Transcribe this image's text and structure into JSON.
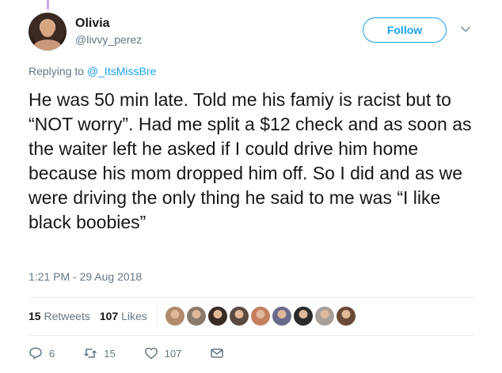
{
  "user": {
    "display_name": "Olivia",
    "handle": "@livvy_perez"
  },
  "follow_label": "Follow",
  "reply": {
    "prefix": "Replying to",
    "mention": "@_ItsMissBre"
  },
  "tweet": {
    "text": "He was 50 min late. Told me his famiy is racist but to “NOT worry”. Had me split a $12 check and as soon as the waiter left he asked if I could drive him home because his mom dropped him off. So I did and as we were driving the only thing he said to me was “I like black boobies”",
    "timestamp": "1:21 PM - 29 Aug 2018"
  },
  "stats": {
    "retweets_count": "15",
    "retweets_label": "Retweets",
    "likes_count": "107",
    "likes_label": "Likes"
  },
  "likers": [
    {
      "color": "#b08a6a"
    },
    {
      "color": "#8a7a6e"
    },
    {
      "color": "#3a2a24"
    },
    {
      "color": "#5a4a40"
    },
    {
      "color": "#c48060"
    },
    {
      "color": "#6a6a8a"
    },
    {
      "color": "#2a2a2a"
    },
    {
      "color": "#a8a09a"
    },
    {
      "color": "#6a4a36"
    }
  ],
  "actions": {
    "reply_count": "6",
    "retweet_count": "15",
    "like_count": "107"
  },
  "colors": {
    "accent": "#1da1f2",
    "secondary_text": "#657786",
    "primary_text": "#14171a",
    "divider": "#e6ecf0"
  },
  "icons": [
    "reply-icon",
    "retweet-icon",
    "heart-icon",
    "message-icon",
    "caret-down-icon"
  ]
}
